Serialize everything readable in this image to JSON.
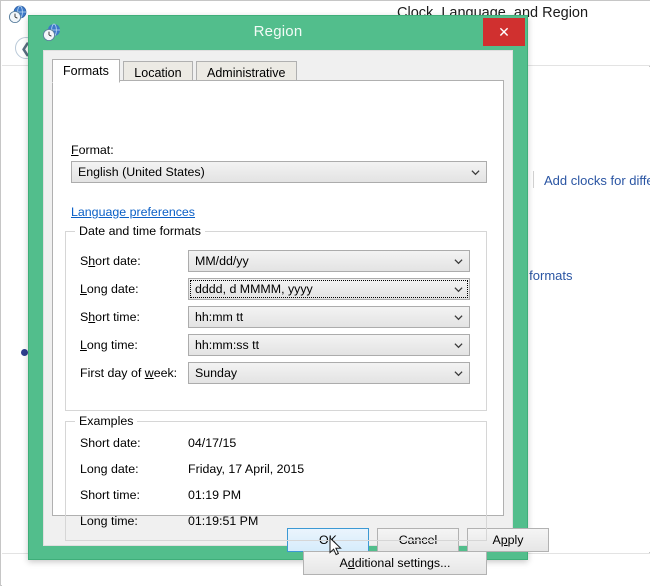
{
  "background": {
    "title": "Clock, Language, and Region",
    "icon": "clock-globe-icon",
    "back_arrow": "❮",
    "links": [
      {
        "label": "Add clocks for differ"
      },
      {
        "label": "er formats"
      }
    ]
  },
  "dialog": {
    "title": "Region",
    "icon": "clock-globe-icon",
    "close_label": "✕",
    "accent_color": "#52be8c",
    "close_color": "#d0302f",
    "tabs": [
      {
        "label": "Formats",
        "active": true
      },
      {
        "label": "Location",
        "active": false
      },
      {
        "label": "Administrative",
        "active": false
      }
    ],
    "format": {
      "label_pre": "F",
      "label_post": "ormat:",
      "value": "English (United States)"
    },
    "language_preferences_link": "Language preferences",
    "date_time_group": {
      "title": "Date and time formats",
      "rows": [
        {
          "label_pre": "S",
          "label_mid": "h",
          "label_post": "ort date:",
          "value": "MM/dd/yy",
          "focused": false
        },
        {
          "label_pre": "",
          "label_mid": "L",
          "label_post": "ong date:",
          "value": "dddd, d MMMM, yyyy",
          "focused": true
        },
        {
          "label_pre": "S",
          "label_mid": "h",
          "label_post": "ort time:",
          "value": "hh:mm tt",
          "focused": false
        },
        {
          "label_pre": "",
          "label_mid": "L",
          "label_post": "ong time:",
          "value": "hh:mm:ss tt",
          "focused": false
        },
        {
          "label_pre": "First day of ",
          "label_mid": "w",
          "label_post": "eek:",
          "value": "Sunday",
          "focused": false
        }
      ]
    },
    "examples_group": {
      "title": "Examples",
      "rows": [
        {
          "label": "Short date:",
          "value": "04/17/15"
        },
        {
          "label": "Long date:",
          "value": "Friday, 17 April, 2015"
        },
        {
          "label": "Short time:",
          "value": "01:19 PM"
        },
        {
          "label": "Long time:",
          "value": "01:19:51 PM"
        }
      ]
    },
    "additional_settings": {
      "pre": "A",
      "acc": "d",
      "post": "ditional settings..."
    },
    "buttons": [
      {
        "id": "ok",
        "label": "OK",
        "hover": true
      },
      {
        "id": "cancel",
        "label": "Cancel",
        "hover": false
      },
      {
        "id": "apply",
        "pre": "A",
        "acc": "p",
        "post": "ply",
        "label": "Apply",
        "hover": false
      }
    ]
  }
}
